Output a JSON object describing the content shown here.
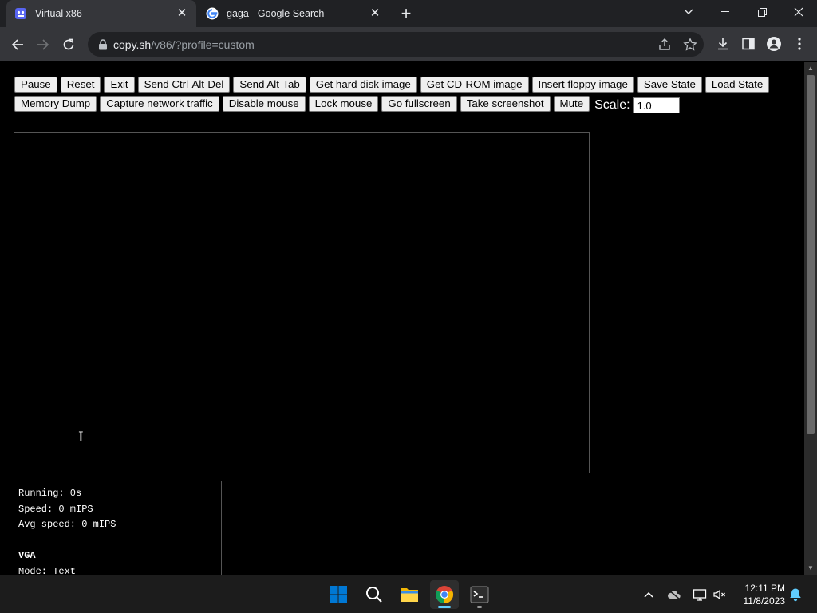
{
  "browser": {
    "tabs": [
      {
        "title": "Virtual x86",
        "active": true
      },
      {
        "title": "gaga - Google Search",
        "active": false
      }
    ],
    "url": {
      "host": "copy.sh",
      "path": "/v86/?profile=custom"
    }
  },
  "toolbar_buttons": {
    "row1": [
      "Pause",
      "Reset",
      "Exit",
      "Send Ctrl-Alt-Del",
      "Send Alt-Tab",
      "Get hard disk image",
      "Get CD-ROM image",
      "Insert floppy image",
      "Save State",
      "Load State"
    ],
    "row2": [
      "Memory Dump",
      "Capture network traffic",
      "Disable mouse",
      "Lock mouse",
      "Go fullscreen",
      "Take screenshot",
      "Mute"
    ],
    "scale_label": "Scale:",
    "scale_value": "1.0"
  },
  "info": {
    "running": "Running: 0s",
    "speed": "Speed: 0 mIPS",
    "avg_speed": "Avg speed: 0 mIPS",
    "vga_heading": "VGA",
    "mode": "Mode: Text"
  },
  "taskbar": {
    "time": "12:11 PM",
    "date": "11/8/2023",
    "icons": [
      "windows-start-icon",
      "search-icon",
      "file-explorer-icon",
      "chrome-icon",
      "terminal-icon"
    ]
  },
  "colors": {
    "tab_active_bg": "#35363a",
    "tabstrip_bg": "#202124",
    "page_bg": "#000000",
    "win_blue": "#0078d4",
    "chrome_indicator": "#60cdff"
  }
}
